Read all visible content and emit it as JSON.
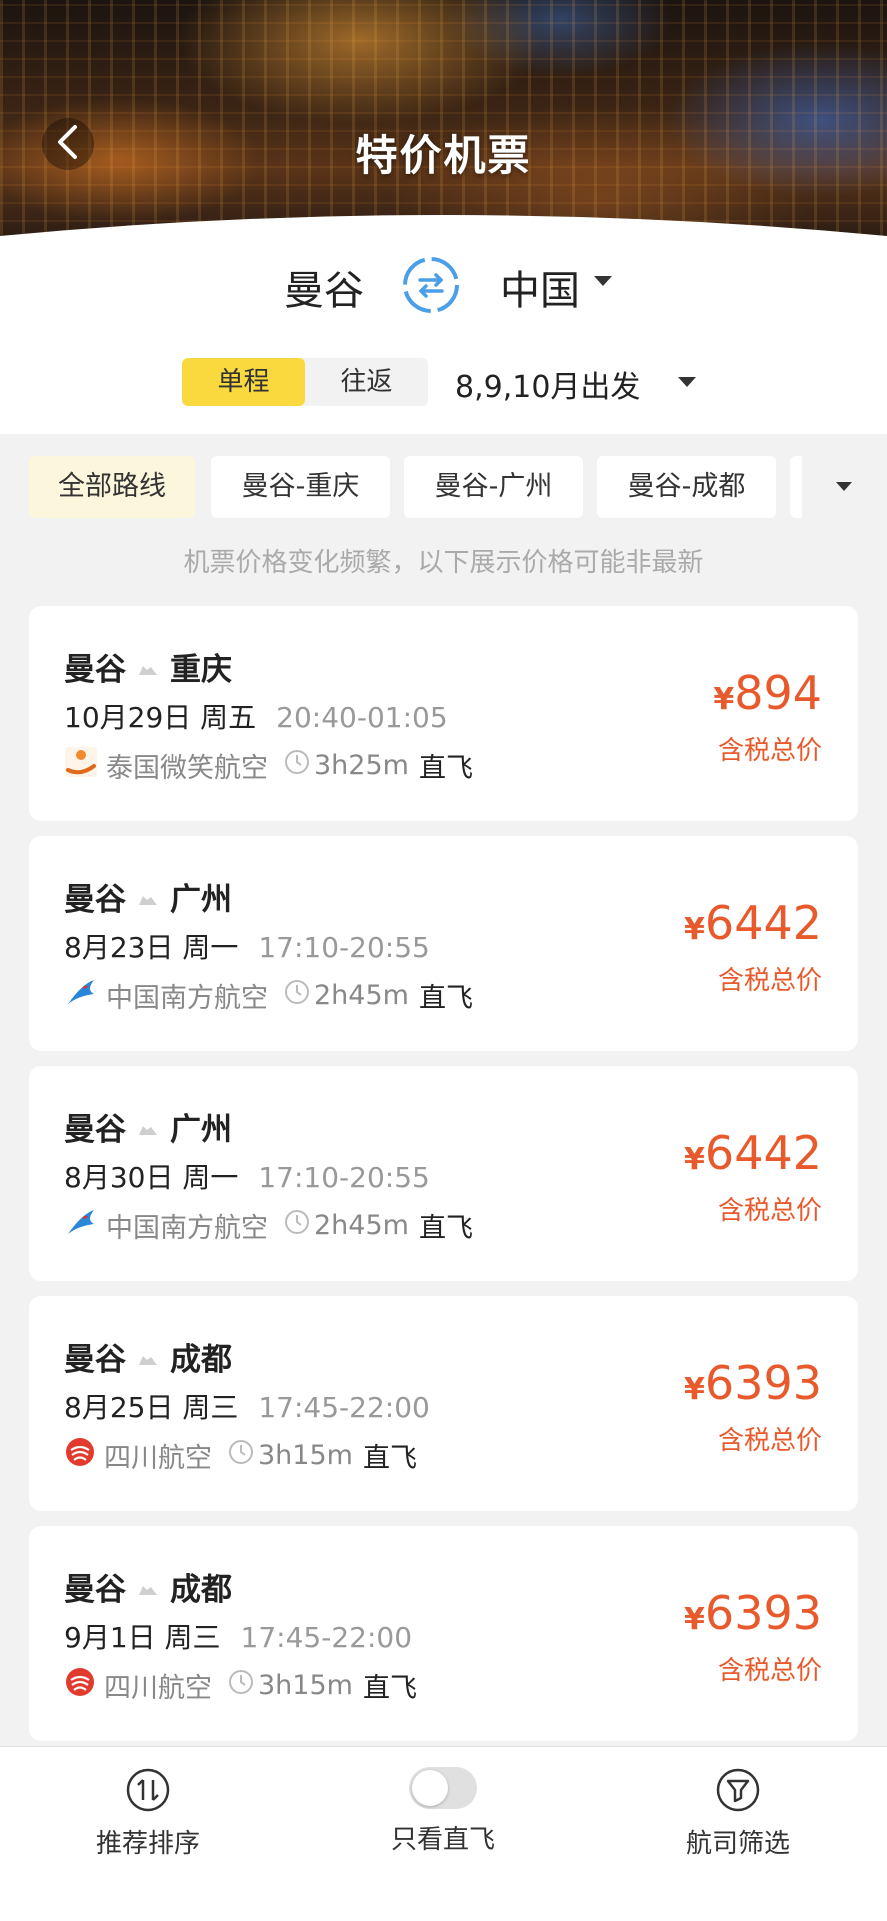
{
  "header": {
    "title": "特价机票"
  },
  "search": {
    "origin": "曼谷",
    "destination": "中国",
    "trip_types": [
      {
        "label": "单程",
        "active": true
      },
      {
        "label": "往返",
        "active": false
      }
    ],
    "departure": "8,9,10月出发"
  },
  "routes": [
    {
      "label": "全部路线",
      "active": true
    },
    {
      "label": "曼谷-重庆",
      "active": false
    },
    {
      "label": "曼谷-广州",
      "active": false
    },
    {
      "label": "曼谷-成都",
      "active": false
    }
  ],
  "notice": "机票价格变化频繁，以下展示价格可能非最新",
  "flights": [
    {
      "from": "曼谷",
      "to": "重庆",
      "date": "10月29日 周五",
      "time": "20:40-01:05",
      "airline": "泰国微笑航空",
      "airline_icon": "thai-smile-logo",
      "duration": "3h25m",
      "type": "直飞",
      "currency": "¥",
      "price": "894",
      "price_note": "含税总价"
    },
    {
      "from": "曼谷",
      "to": "广州",
      "date": "8月23日 周一",
      "time": "17:10-20:55",
      "airline": "中国南方航空",
      "airline_icon": "china-southern-logo",
      "duration": "2h45m",
      "type": "直飞",
      "currency": "¥",
      "price": "6442",
      "price_note": "含税总价"
    },
    {
      "from": "曼谷",
      "to": "广州",
      "date": "8月30日 周一",
      "time": "17:10-20:55",
      "airline": "中国南方航空",
      "airline_icon": "china-southern-logo",
      "duration": "2h45m",
      "type": "直飞",
      "currency": "¥",
      "price": "6442",
      "price_note": "含税总价"
    },
    {
      "from": "曼谷",
      "to": "成都",
      "date": "8月25日 周三",
      "time": "17:45-22:00",
      "airline": "四川航空",
      "airline_icon": "sichuan-airlines-logo",
      "duration": "3h15m",
      "type": "直飞",
      "currency": "¥",
      "price": "6393",
      "price_note": "含税总价"
    },
    {
      "from": "曼谷",
      "to": "成都",
      "date": "9月1日 周三",
      "time": "17:45-22:00",
      "airline": "四川航空",
      "airline_icon": "sichuan-airlines-logo",
      "duration": "3h15m",
      "type": "直飞",
      "currency": "¥",
      "price": "6393",
      "price_note": "含税总价"
    }
  ],
  "bottom_bar": {
    "sort_label": "推荐排序",
    "direct_label": "只看直飞",
    "direct_on": false,
    "filter_label": "航司筛选"
  },
  "colors": {
    "accent_yellow": "#f9d93d",
    "price_orange": "#e85a2c",
    "swap_blue": "#4a9fe8"
  }
}
